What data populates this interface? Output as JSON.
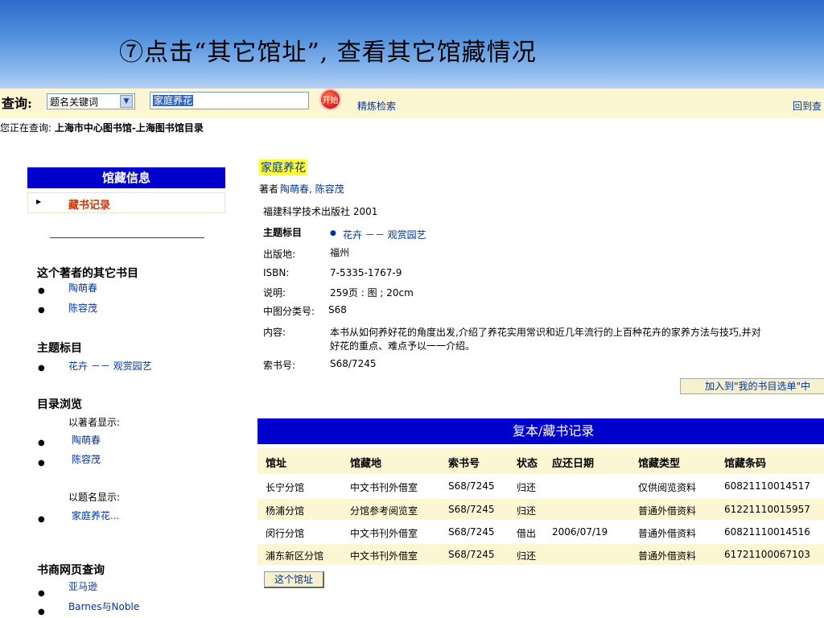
{
  "banner": {
    "title": "⑦点击“其它馆址”, 查看其它馆藏情况"
  },
  "search": {
    "label": "查询:",
    "field_option": "题名关键词",
    "query": "家庭养花",
    "go_label": "开始",
    "refine_label": "精炼检索",
    "back_label": "回到查"
  },
  "current_library": {
    "prefix": "您正在查询:",
    "name": "上海市中心图书馆-上海图书馆目录"
  },
  "sidebar": {
    "header": "馆藏信息",
    "selected_item": "藏书记录",
    "other_works_title": "这个著者的其它书目",
    "other_works": [
      "陶萌春",
      "陈容茂"
    ],
    "subject_title": "主题标目",
    "subjects": [
      "花卉 －－ 观赏园艺"
    ],
    "browse_title": "目录浏览",
    "browse_by_author": "以著者显示:",
    "browse_authors": [
      "陶萌春",
      "陈容茂"
    ],
    "browse_by_title": "以题名显示:",
    "browse_titles": [
      "家庭养花..."
    ],
    "bookstore_title": "书商网页查询",
    "bookstores": [
      "亚马逊",
      "Barnes与Noble"
    ]
  },
  "record": {
    "title": "家庭养花",
    "author_prefix": "著者",
    "authors": "陶萌春, 陈容茂",
    "publisher_line": "福建科学技术出版社 2001",
    "subject_label": "主题标目",
    "subject_value": "花卉 －－ 观赏园艺",
    "place_label": "出版地:",
    "place_value": "福州",
    "isbn_label": "ISBN:",
    "isbn_value": "7-5335-1767-9",
    "desc_label": "说明:",
    "desc_value": "259页 : 图 ; 20cm",
    "clc_label": "中图分类号:",
    "clc_value": "S68",
    "content_label": "内容:",
    "content_line1": "本书从如何养好花的角度出发,介绍了养花实用常识和近几年流行的上百种花卉的家养方法与技巧,并对",
    "content_line2": "好花的重点、难点予以一一介绍。",
    "call_label": "索书号:",
    "call_value": "S68/7245",
    "add_button": "加入到\"我的书目选单\"中"
  },
  "holdings": {
    "title": "复本/藏书记录",
    "columns": [
      "馆址",
      "馆藏地",
      "索书号",
      "状态",
      "应还日期",
      "馆藏类型",
      "馆藏条码"
    ],
    "rows": [
      [
        "长宁分馆",
        "中文书刊外借室",
        "S68/7245",
        "归还",
        "",
        "仅供阅览资料",
        "60821110014517"
      ],
      [
        "杨浦分馆",
        "分馆参考阅览室",
        "S68/7245",
        "归还",
        "",
        "普通外借资料",
        "61221110015957"
      ],
      [
        "闵行分馆",
        "中文书刊外借室",
        "S68/7245",
        "借出",
        "2006/07/19",
        "普通外借资料",
        "60821110014516"
      ],
      [
        "浦东新区分馆",
        "中文书刊外借室",
        "S68/7245",
        "归还",
        "",
        "普通外借资料",
        "61721100067103"
      ]
    ],
    "this_library_button": "这个馆址"
  }
}
